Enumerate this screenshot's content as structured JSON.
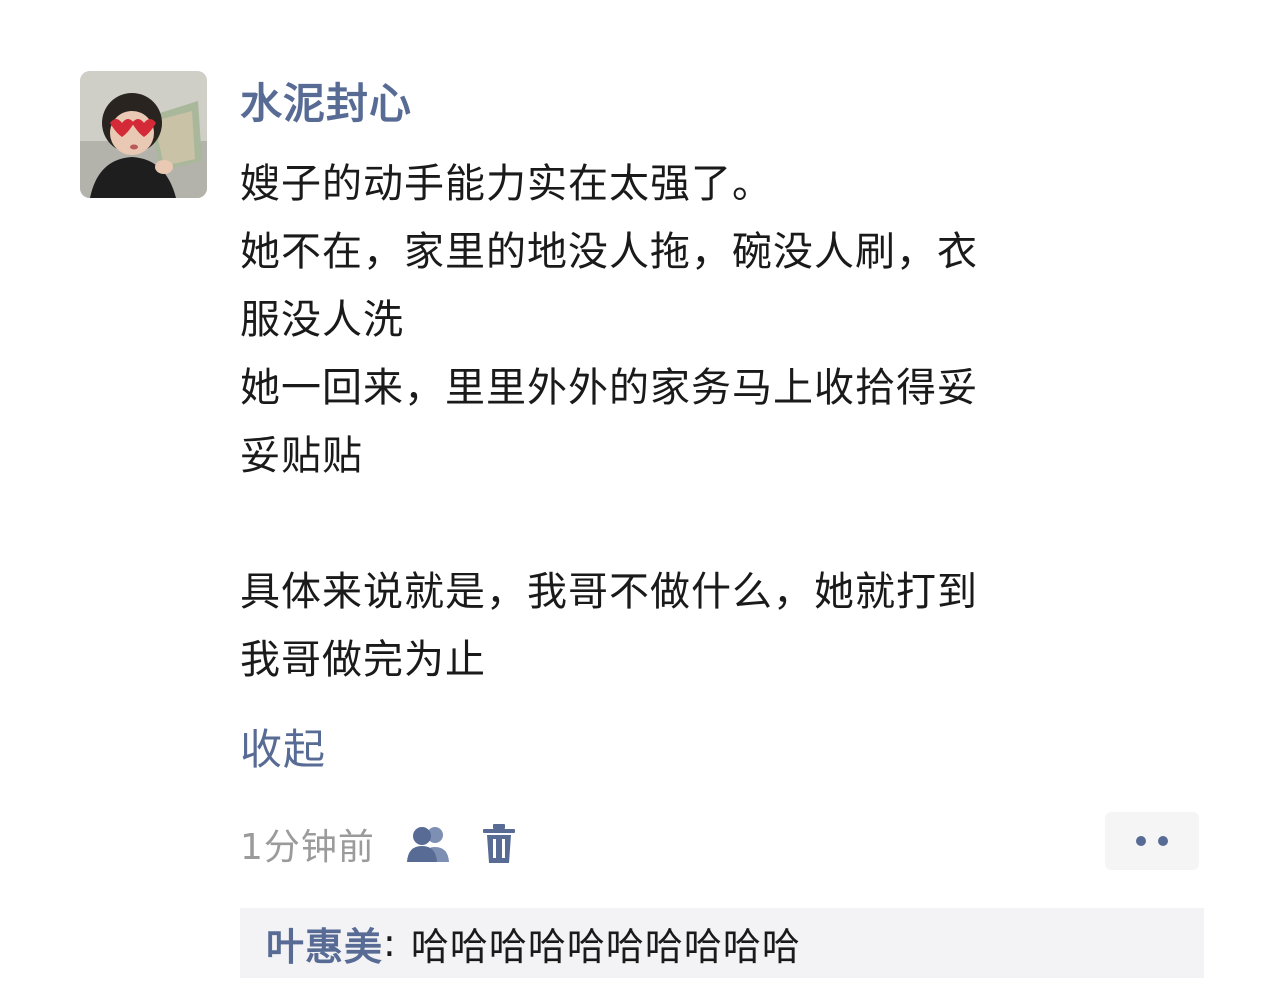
{
  "post": {
    "username": "水泥封心",
    "content_lines": [
      "嫂子的动手能力实在太强了。",
      "她不在，家里的地没人拖，碗没人刷，衣",
      "服没人洗",
      "她一回来，里里外外的家务马上收拾得妥",
      "妥贴贴",
      "",
      "具体来说就是，我哥不做什么，她就打到",
      "我哥做完为止"
    ],
    "collapse_label": "收起",
    "timestamp": "1分钟前",
    "icons": {
      "avatar": "avatar-photo",
      "privacy": "people-icon",
      "delete": "trash-icon",
      "more": "more-dots-icon"
    },
    "accent_color": "#576b95"
  },
  "comments": [
    {
      "author": "叶惠美",
      "separator": ":",
      "text": "哈哈哈哈哈哈哈哈哈哈"
    }
  ]
}
